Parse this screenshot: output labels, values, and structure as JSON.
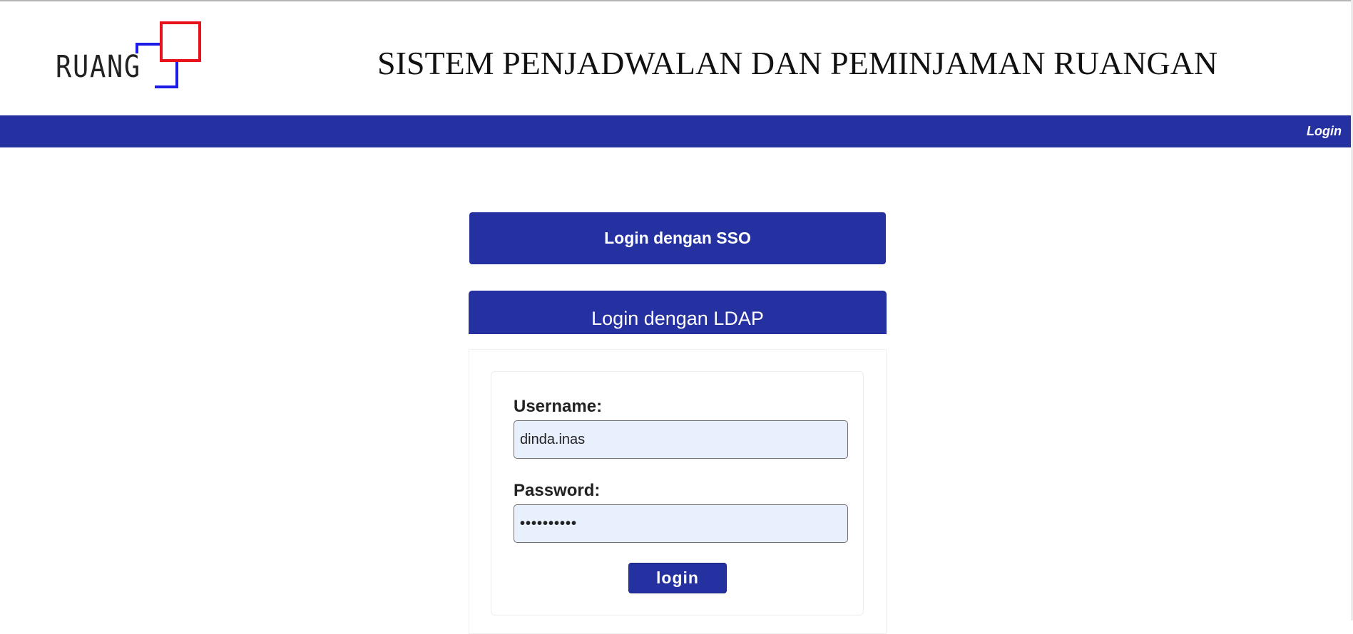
{
  "header": {
    "logo_text": "RUANG",
    "site_title": "SISTEM PENJADWALAN DAN PEMINJAMAN RUANGAN"
  },
  "navbar": {
    "login_link": "Login"
  },
  "sso": {
    "button_label": "Login dengan SSO"
  },
  "ldap": {
    "panel_title": "Login dengan LDAP",
    "username_label": "Username:",
    "username_value": "dinda.inas",
    "password_label": "Password:",
    "password_value": "••••••••••",
    "submit_label": "login"
  },
  "colors": {
    "primary": "#2531a0",
    "logo_red": "#e8111c",
    "logo_blue": "#1c1ce6",
    "input_bg": "#e8f0fe"
  }
}
